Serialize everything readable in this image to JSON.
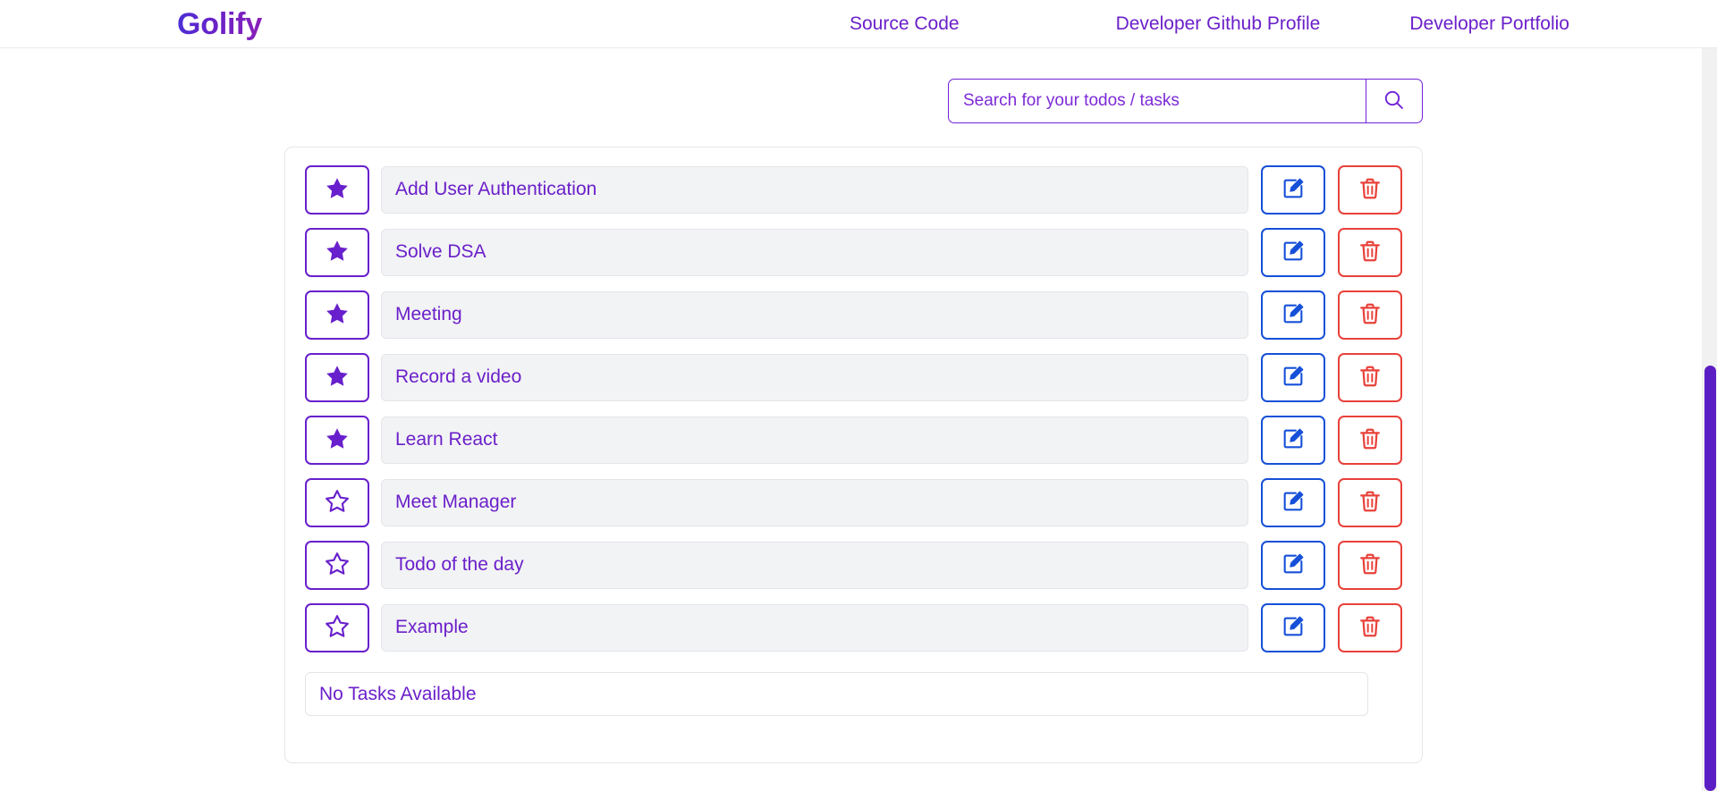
{
  "header": {
    "brand": "Golify",
    "nav": [
      {
        "label": "Source Code",
        "name": "nav-link-source-code"
      },
      {
        "label": "Developer Github Profile",
        "name": "nav-link-developer-github-profile"
      },
      {
        "label": "Developer Portfolio",
        "name": "nav-link-developer-portfolio"
      }
    ]
  },
  "search": {
    "placeholder": "Search for your todos / tasks",
    "value": "",
    "icon": "search-icon"
  },
  "tasks": {
    "items": [
      {
        "label": "Add User Authentication",
        "starred": true
      },
      {
        "label": "Solve DSA",
        "starred": true
      },
      {
        "label": "Meeting",
        "starred": true
      },
      {
        "label": "Record a video",
        "starred": true
      },
      {
        "label": "Learn React",
        "starred": true
      },
      {
        "label": "Meet Manager",
        "starred": false
      },
      {
        "label": "Todo of the day",
        "starred": false
      },
      {
        "label": "Example",
        "starred": false
      }
    ],
    "empty_message": "No Tasks Available",
    "row_icons": {
      "star_filled": "star-filled-icon",
      "star_outline": "star-outline-icon",
      "edit": "edit-pencil-icon",
      "delete": "trash-icon"
    }
  },
  "colors": {
    "primary_purple": "#6b20c9",
    "star_border": "#6820cc",
    "edit_blue": "#1650d8",
    "delete_red": "#e8413a",
    "row_bg": "#f2f3f5",
    "scrollbar_thumb": "#5b1ec4"
  }
}
